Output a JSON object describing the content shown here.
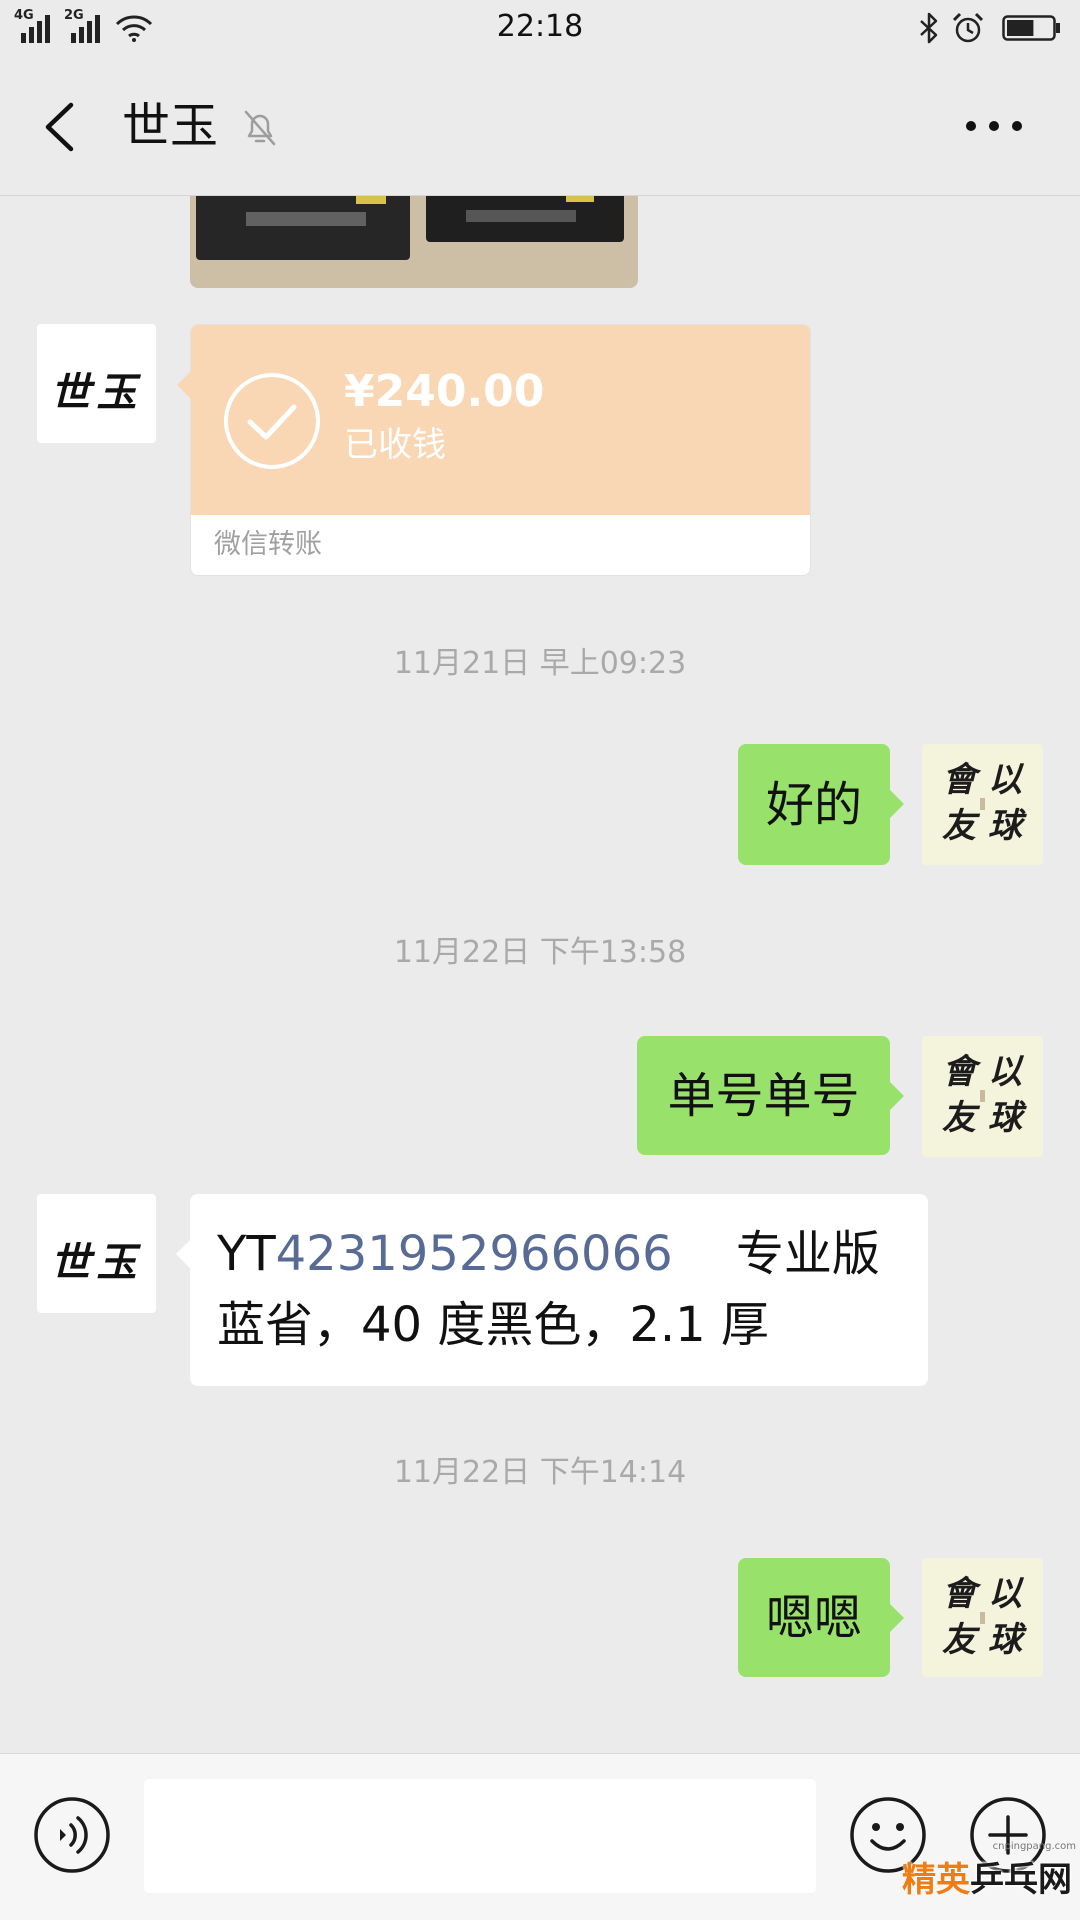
{
  "status_bar": {
    "network_1": "4G",
    "network_2": "2G",
    "time": "22:18",
    "battery_level": 0.6
  },
  "header": {
    "title": "世玉"
  },
  "contact": {
    "avatar_text": "世玉"
  },
  "me": {
    "avatar_chars": [
      "以",
      "球",
      "會",
      "友"
    ]
  },
  "messages": [
    {
      "received_photo": {}
    },
    {
      "received_transfer": {
        "amount": "¥240.00",
        "status": "已收钱",
        "label": "微信转账"
      }
    },
    {
      "time": "11月21日 早上09:23"
    },
    {
      "sent": "好的"
    },
    {
      "time": "11月22日 下午13:58"
    },
    {
      "sent": "单号单号"
    },
    {
      "received": {
        "prefix": "YT",
        "tracking_number": "4231952966066",
        "rest": "　 专业版蓝省，40 度黑色，2.1 厚"
      }
    },
    {
      "time": "11月22日 下午14:14"
    },
    {
      "sent": "嗯嗯"
    }
  ],
  "watermark": {
    "site": "cnpingpang.com",
    "name_accent": "精英",
    "name_rest": "乒乓网"
  },
  "icons": {
    "back": "chevron-left-icon",
    "mute": "bell-off-icon",
    "more": "more-dots-icon",
    "voice": "voice-icon",
    "emoji": "emoji-icon",
    "plus": "plus-icon",
    "transfer_received": "check-circle-icon"
  },
  "colors": {
    "background": "#ebebeb",
    "sent_bubble": "#98e26b",
    "transfer_card": "#f9d7b4",
    "link": "#576b95",
    "timestamp": "#a9a9a9"
  }
}
